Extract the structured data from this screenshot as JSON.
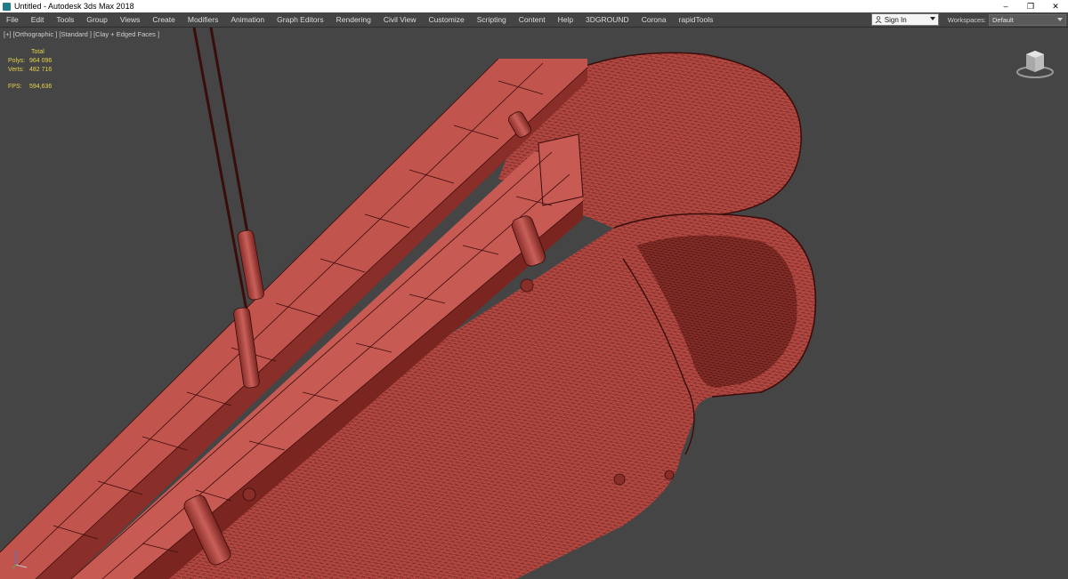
{
  "window": {
    "title": "Untitled - Autodesk 3ds Max 2018",
    "minimize_glyph": "–",
    "restore_glyph": "❐",
    "close_glyph": "✕"
  },
  "menu": {
    "items": [
      "File",
      "Edit",
      "Tools",
      "Group",
      "Views",
      "Create",
      "Modifiers",
      "Animation",
      "Graph Editors",
      "Rendering",
      "Civil View",
      "Customize",
      "Scripting",
      "Content",
      "Help",
      "3DGROUND",
      "Corona",
      "rapidTools"
    ]
  },
  "signin": {
    "label": "Sign In"
  },
  "workspaces": {
    "label": "Workspaces:",
    "value": "Default"
  },
  "viewport": {
    "label": "[+] [Orthographic ] [Standard ] [Clay + Edged Faces ]",
    "stats": {
      "header": "Total",
      "polys_label": "Polys:",
      "polys_value": "964 096",
      "verts_label": "Verts:",
      "verts_value": "482 716",
      "fps_label": "FPS:",
      "fps_value": "594,636"
    }
  },
  "icons": {
    "app": "3ds-max-icon",
    "user": "user-icon",
    "viewcube": "viewcube-icon",
    "axis": "axis-tripod-icon"
  },
  "colors": {
    "clay": "#c2544e",
    "clay_dark": "#7a2520",
    "wire": "#3a0d0b",
    "viewport_bg": "#454545",
    "stats_text": "#e4d24a"
  }
}
